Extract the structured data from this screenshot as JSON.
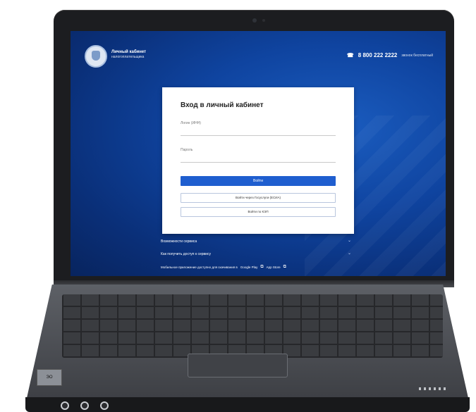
{
  "header": {
    "title": "Личный кабинет",
    "subtitle": "налогоплательщика",
    "phone": "8 800 222 2222",
    "phone_note": "звонок бесплатный"
  },
  "login": {
    "title": "Вход в личный кабинет",
    "login_label": "Логин (ИНН)",
    "login_value": "",
    "password_label": "Пароль",
    "password_value": "",
    "submit_label": "Войти",
    "alt1_label": "Войти через Госуслуги (ЕСИА)",
    "alt2_label": "Войти по КЭП"
  },
  "links": {
    "item1": "Возможности сервиса",
    "item2": "Как получить доступ к сервису",
    "apps_text": "Мобильное приложение доступно для скачивания в",
    "app_store": "App Store",
    "google_play": "Google Play"
  },
  "laptop": {
    "sticker": "ЭО"
  },
  "colors": {
    "screen_bg": "#0f44a0",
    "primary_button": "#1f5ecf",
    "bezel": "#1c1d20"
  }
}
